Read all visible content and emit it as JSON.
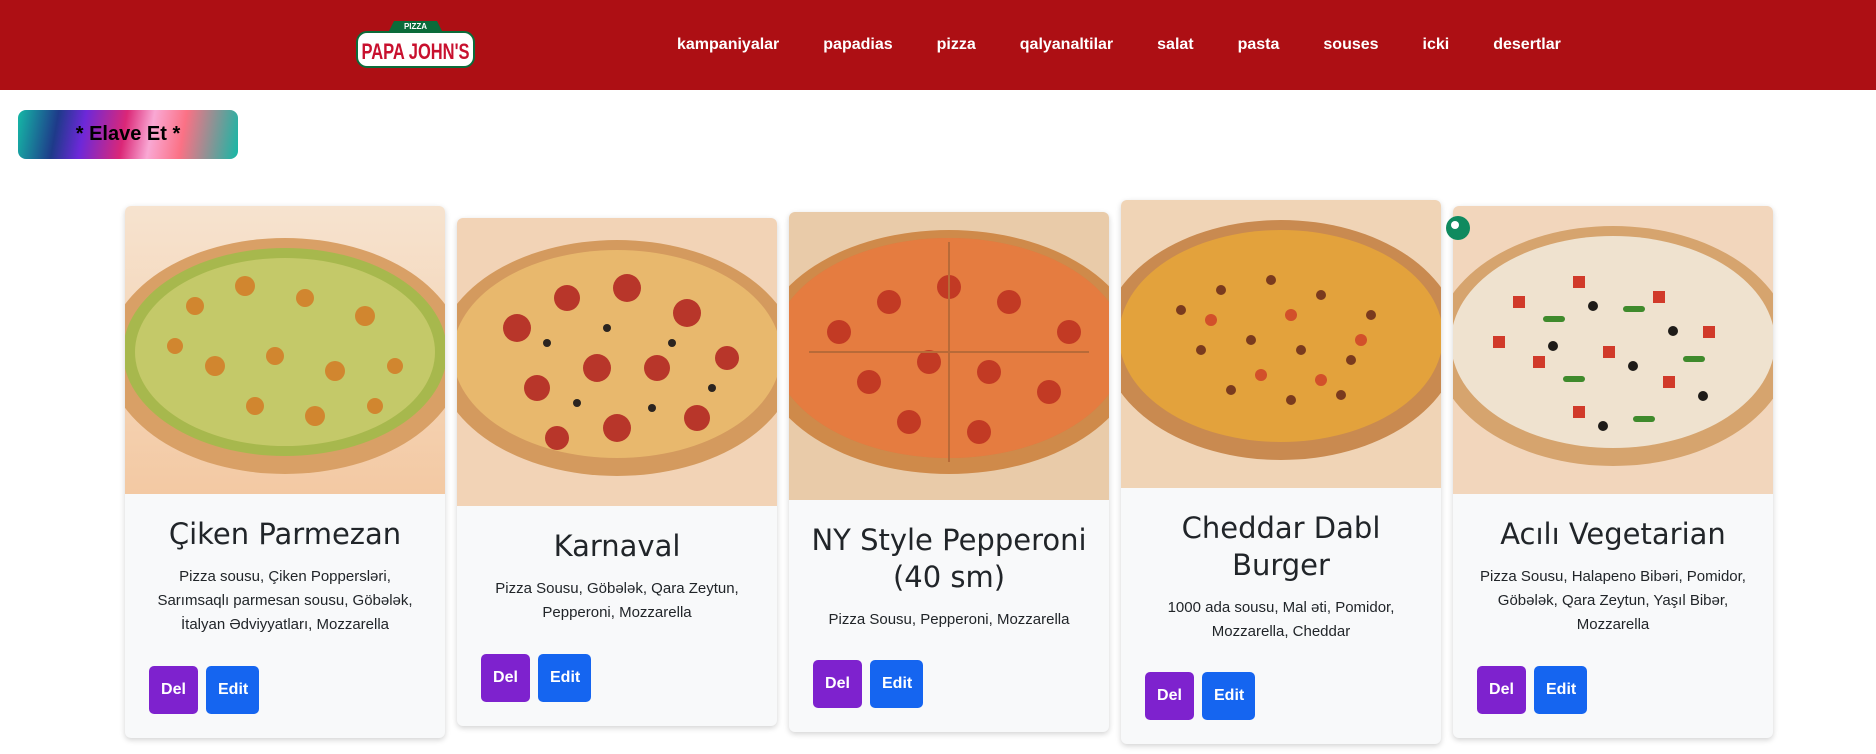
{
  "brand": {
    "logo_top": "PIZZA",
    "logo_main": "PAPA JOHN'S"
  },
  "nav": [
    {
      "label": "kampaniyalar"
    },
    {
      "label": "papadias"
    },
    {
      "label": "pizza"
    },
    {
      "label": "qalyanaltilar"
    },
    {
      "label": "salat"
    },
    {
      "label": "pasta"
    },
    {
      "label": "souses"
    },
    {
      "label": "icki"
    },
    {
      "label": "desertlar"
    }
  ],
  "add_button": {
    "label": "* Elave Et *"
  },
  "cards": [
    {
      "title": "Çiken Parmezan",
      "description": "Pizza sousu, Çiken Poppersləri, Sarımsaqlı parmesan sousu, Göbələk, İtalyan Ədviyyatları, Mozzarella",
      "del_label": "Del",
      "edit_label": "Edit"
    },
    {
      "title": "Karnaval",
      "description": "Pizza Sousu, Göbələk, Qara Zeytun, Pepperoni, Mozzarella",
      "del_label": "Del",
      "edit_label": "Edit"
    },
    {
      "title": "NY Style Pepperoni (40 sm)",
      "description": "Pizza Sousu, Pepperoni, Mozzarella",
      "del_label": "Del",
      "edit_label": "Edit"
    },
    {
      "title": "Cheddar Dabl Burger",
      "description": "1000 ada sousu, Mal əti, Pomidor, Mozzarella, Cheddar",
      "del_label": "Del",
      "edit_label": "Edit"
    },
    {
      "title": "Acılı Vegetarian",
      "description": "Pizza Sousu, Halapeno Bibəri, Pomidor, Göbələk, Qara Zeytun, Yaşıl Bibər, Mozzarella",
      "del_label": "Del",
      "edit_label": "Edit"
    }
  ],
  "colors": {
    "navbar": "#ad0f14",
    "del_button": "#7e22ce",
    "edit_button": "#1565f0"
  }
}
